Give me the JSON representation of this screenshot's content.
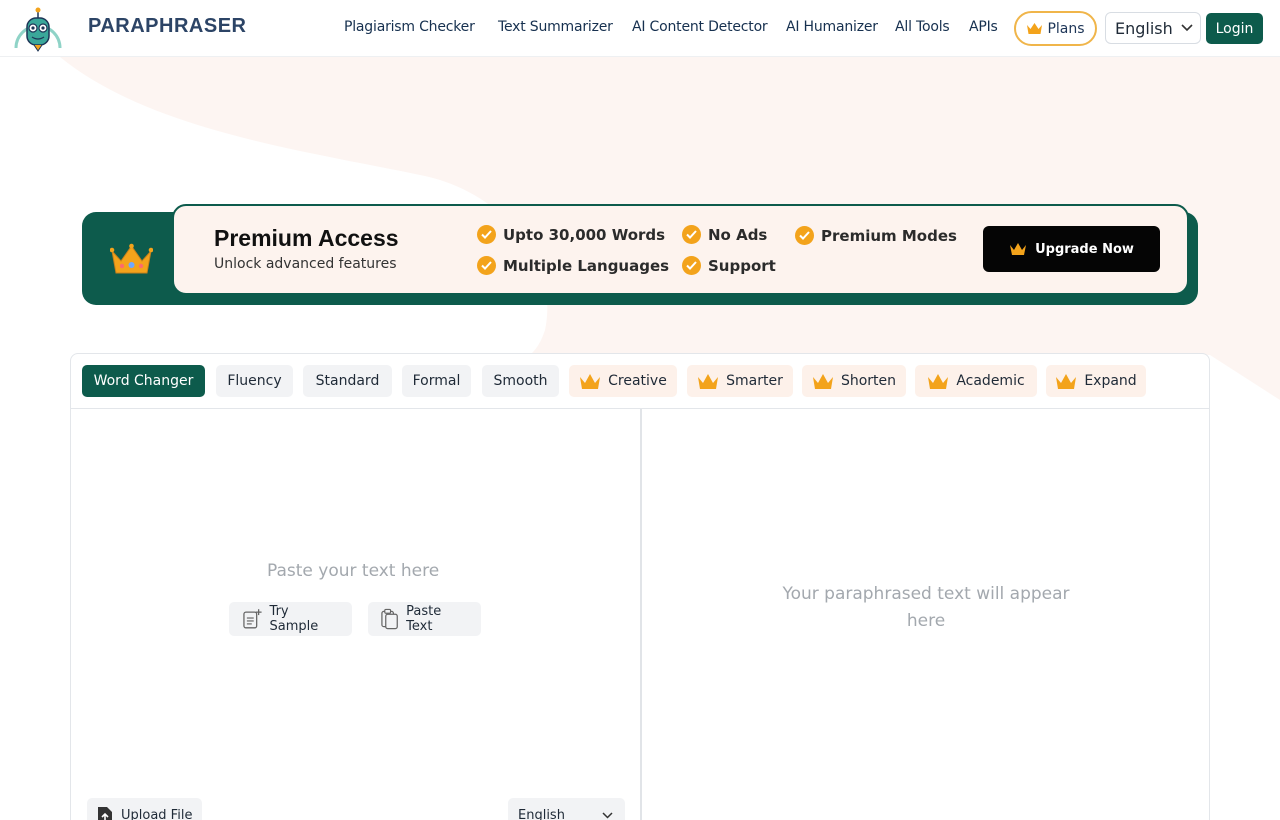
{
  "header": {
    "brand": "PARAPHRASER",
    "nav": [
      {
        "label": "Plagiarism Checker"
      },
      {
        "label": "Text Summarizer"
      },
      {
        "label": "AI Content Detector"
      },
      {
        "label": "AI Humanizer"
      },
      {
        "label": "All Tools"
      },
      {
        "label": "APIs"
      }
    ],
    "plans_label": "Plans",
    "language": "English",
    "login_label": "Login"
  },
  "premium": {
    "title": "Premium Access",
    "subtitle": "Unlock advanced features",
    "features": [
      "Upto 30,000 Words",
      "No Ads",
      "Premium Modes",
      "Multiple Languages",
      "Support"
    ],
    "upgrade_label": "Upgrade Now"
  },
  "modes": [
    {
      "label": "Word Changer",
      "active": true,
      "premium": false
    },
    {
      "label": "Fluency",
      "active": false,
      "premium": false
    },
    {
      "label": "Standard",
      "active": false,
      "premium": false
    },
    {
      "label": "Formal",
      "active": false,
      "premium": false
    },
    {
      "label": "Smooth",
      "active": false,
      "premium": false
    },
    {
      "label": "Creative",
      "active": false,
      "premium": true
    },
    {
      "label": "Smarter",
      "active": false,
      "premium": true
    },
    {
      "label": "Shorten",
      "active": false,
      "premium": true
    },
    {
      "label": "Academic",
      "active": false,
      "premium": true
    },
    {
      "label": "Expand",
      "active": false,
      "premium": true
    }
  ],
  "editor": {
    "input_placeholder": "Paste your text here",
    "try_sample_label": "Try Sample",
    "paste_text_label": "Paste Text",
    "output_placeholder": "Your paraphrased text will appear here",
    "upload_label": "Upload File",
    "input_language": "English"
  },
  "colors": {
    "brand_green": "#0d5b4c",
    "crown_gold": "#f3a31b",
    "premium_bg": "#fdf3ee"
  }
}
